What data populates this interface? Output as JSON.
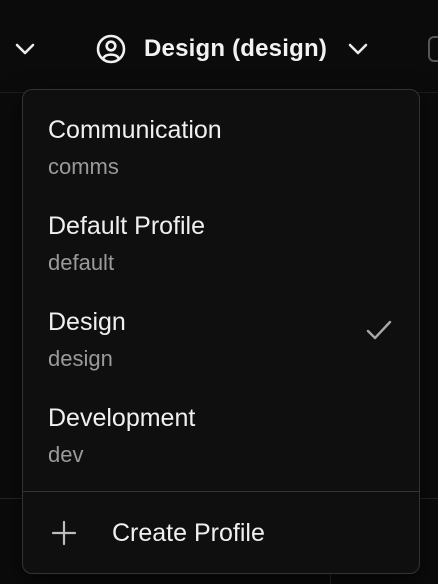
{
  "topbar": {
    "profile_trigger_label": "Design (design)"
  },
  "profile_menu": {
    "items": [
      {
        "name": "Communication",
        "slug": "comms",
        "selected": false
      },
      {
        "name": "Default Profile",
        "slug": "default",
        "selected": false
      },
      {
        "name": "Design",
        "slug": "design",
        "selected": true
      },
      {
        "name": "Development",
        "slug": "dev",
        "selected": false
      }
    ],
    "create_label": "Create Profile"
  },
  "colors": {
    "background": "#0b0b0b",
    "menu_background": "#0f0f0f",
    "menu_border": "#333333",
    "primary_text": "#f0f0f0",
    "secondary_text": "#9a9a9a"
  },
  "icons": {
    "left_chevron": "chevron-down-icon",
    "profile": "user-circle-icon",
    "trigger_chevron": "chevron-down-icon",
    "selected": "check-icon",
    "create": "plus-icon"
  }
}
